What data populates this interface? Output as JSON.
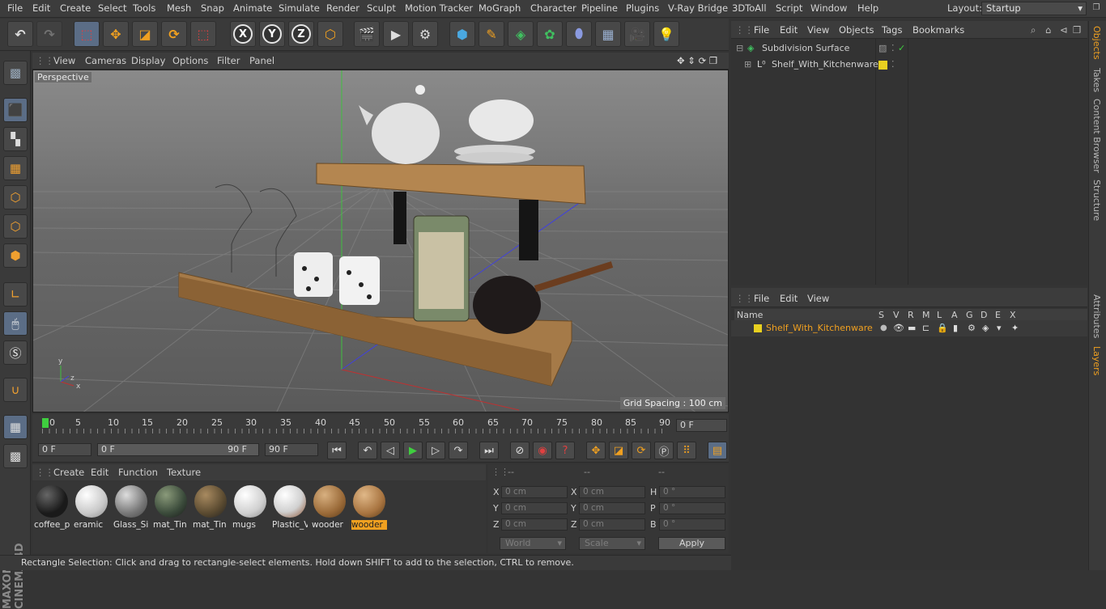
{
  "menubar": {
    "items": [
      "File",
      "Edit",
      "Create",
      "Select",
      "Tools",
      "Mesh",
      "Snap",
      "Animate",
      "Simulate",
      "Render",
      "Sculpt",
      "Motion Tracker",
      "MoGraph",
      "Character",
      "Pipeline",
      "Plugins",
      "V-Ray Bridge",
      "3DToAll",
      "Script",
      "Window",
      "Help"
    ],
    "layout_label": "Layout:",
    "layout_value": "Startup"
  },
  "toolbar": {
    "axis_x": "X",
    "axis_y": "Y",
    "axis_z": "Z"
  },
  "viewport": {
    "menu": [
      "View",
      "Cameras",
      "Display",
      "Options",
      "Filter",
      "Panel"
    ],
    "label": "Perspective",
    "grid_spacing": "Grid Spacing : 100 cm"
  },
  "timeline": {
    "ticks": [
      "0",
      "5",
      "10",
      "15",
      "20",
      "25",
      "30",
      "35",
      "40",
      "45",
      "50",
      "55",
      "60",
      "65",
      "70",
      "75",
      "80",
      "85",
      "90"
    ],
    "current_frame": "0 F"
  },
  "playbar": {
    "start": "0 F",
    "range_start": "0 F",
    "range_end": "90 F",
    "end": "90 F"
  },
  "materials": {
    "menu": [
      "Create",
      "Edit",
      "Function",
      "Texture"
    ],
    "items": [
      {
        "name": "coffee_p",
        "color": "#1a1a1a"
      },
      {
        "name": "eramic",
        "color": "#e8e8e8"
      },
      {
        "name": "Glass_Si",
        "color": "#9a9a9a"
      },
      {
        "name": "mat_Tin",
        "color": "#4a5a4a"
      },
      {
        "name": "mat_Tin",
        "color": "#6a5540"
      },
      {
        "name": "mugs",
        "color": "#d8d8d8"
      },
      {
        "name": "Plastic_V",
        "color": "#d0d0d0"
      },
      {
        "name": "wooder",
        "color": "#a07040"
      },
      {
        "name": "wooder",
        "color": "#b07a45"
      }
    ]
  },
  "coords": {
    "headers": [
      "--",
      "--",
      "--"
    ],
    "rows": [
      {
        "l1": "X",
        "v1": "0 cm",
        "l2": "X",
        "v2": "0 cm",
        "l3": "H",
        "v3": "0 °"
      },
      {
        "l1": "Y",
        "v1": "0 cm",
        "l2": "Y",
        "v2": "0 cm",
        "l3": "P",
        "v3": "0 °"
      },
      {
        "l1": "Z",
        "v1": "0 cm",
        "l2": "Z",
        "v2": "0 cm",
        "l3": "B",
        "v3": "0 °"
      }
    ],
    "mode": "World",
    "scale": "Scale",
    "apply": "Apply"
  },
  "status": "Rectangle Selection: Click and drag to rectangle-select elements. Hold down SHIFT to add to the selection, CTRL to remove.",
  "objects": {
    "menu": [
      "File",
      "Edit",
      "View",
      "Objects",
      "Tags",
      "Bookmarks"
    ],
    "items": [
      "Subdivision Surface",
      "Shelf_With_Kitchenware"
    ]
  },
  "layers": {
    "menu": [
      "File",
      "Edit",
      "View"
    ],
    "columns": [
      "Name",
      "S",
      "V",
      "R",
      "M",
      "L",
      "A",
      "G",
      "D",
      "E",
      "X"
    ],
    "items": [
      "Shelf_With_Kitchenware"
    ]
  },
  "right_tabs": [
    "Objects",
    "Takes",
    "Content Browser",
    "Structure",
    "Attributes",
    "Layers"
  ],
  "colors": {
    "accent": "#f0a020",
    "layer": "#e8d020"
  }
}
